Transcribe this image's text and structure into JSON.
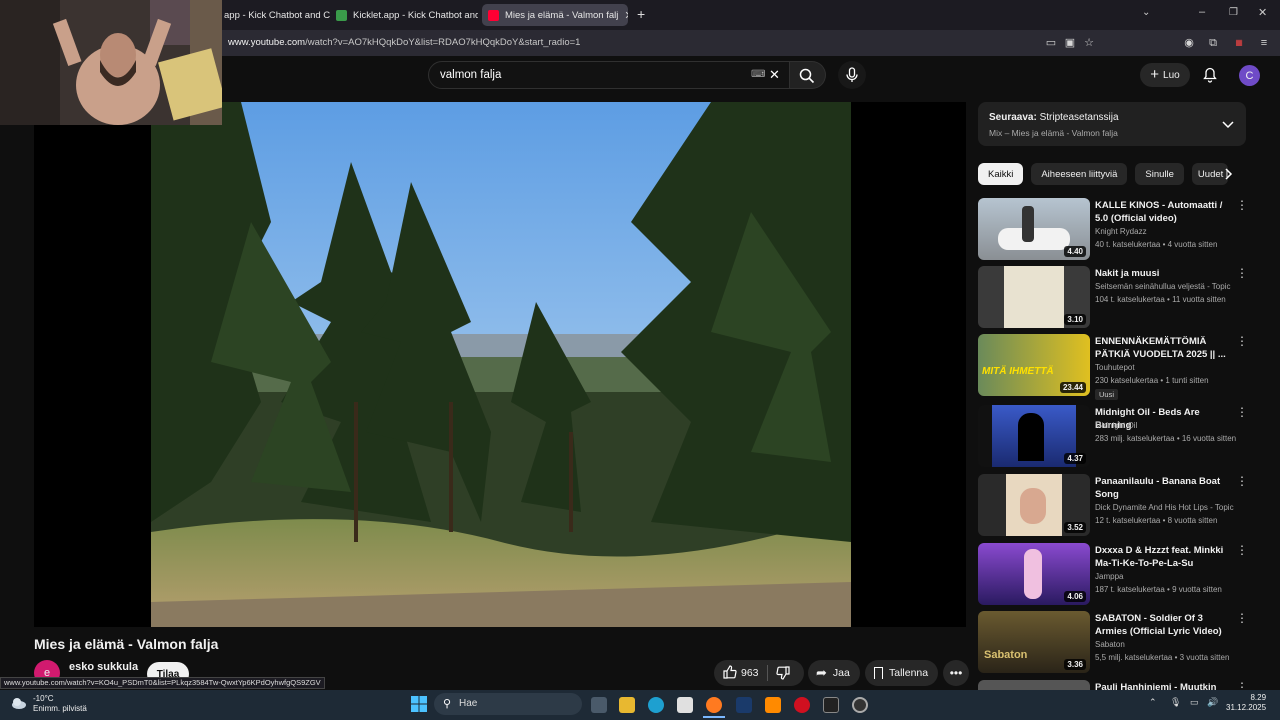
{
  "browser": {
    "tabs": [
      {
        "label": "app - Kick Chatbot and C"
      },
      {
        "label": "Kicklet.app - Kick Chatbot and C"
      },
      {
        "label": "Mies ja elämä - Valmon falj"
      }
    ],
    "url_prefix": "www.youtube.com",
    "url_rest": "/watch?v=AO7kHQqkDoY&list=RDAO7kHQqkDoY&start_radio=1",
    "status_url": "www.youtube.com/watch?v=KO4u_PSDmT0&list=PLkqz3584Tw-QwxtYp6KPdOyhwfgQS9ZGV"
  },
  "youtube": {
    "search_value": "valmon falja",
    "create_label": "Luo",
    "avatar_letter": "C"
  },
  "video": {
    "title": "Mies ja elämä - Valmon falja",
    "channel_initial": "e",
    "channel": "esko sukkula",
    "subscribe_label": "Tilaa",
    "likes": "963",
    "share_label": "Jaa",
    "save_label": "Tallenna"
  },
  "next_up": {
    "label": "Seuraava:",
    "title": "Stripteasetanssija",
    "mix": "Mix – Mies ja elämä - Valmon falja"
  },
  "chips": [
    "Kaikki",
    "Aiheeseen liittyviä",
    "Sinulle",
    "Uudet l"
  ],
  "recommendations": [
    {
      "title": "KALLE KINOS - Automaatti / 5.0 (Official video)",
      "channel": "Knight Rydazz",
      "meta": "40 t. katselukertaa • 4 vuotta sitten",
      "duration": "4.40"
    },
    {
      "title": "Nakit ja muusi",
      "channel": "Seitsemän seinähullua veljestä - Topic",
      "meta": "104 t. katselukertaa • 11 vuotta sitten",
      "duration": "3.10"
    },
    {
      "title": "ENNENNÄKEMÄTTÖMIÄ PÄTKIÄ VUODELTA 2025 || ...",
      "channel": "Touhutepot",
      "meta": "230 katselukertaa • 1 tunti sitten",
      "duration": "23.44",
      "badge": "Uusi"
    },
    {
      "title": "Midnight Oil - Beds Are Burning",
      "channel": "Midnight Oil",
      "meta": "283 milj. katselukertaa • 16 vuotta sitten",
      "duration": "4.37"
    },
    {
      "title": "Panaanilaulu - Banana Boat Song",
      "channel": "Dick Dynamite And His Hot Lips - Topic",
      "meta": "12 t. katselukertaa • 8 vuotta sitten",
      "duration": "3.52"
    },
    {
      "title": "Dxxxa D & Hzzzt feat. Minkki Ma-Ti-Ke-To-Pe-La-Su",
      "channel": "Jamppa",
      "meta": "187 t. katselukertaa • 9 vuotta sitten",
      "duration": "4.06"
    },
    {
      "title": "SABATON - Soldier Of 3 Armies (Official Lyric Video)",
      "channel": "Sabaton",
      "meta": "5,5 milj. katselukertaa • 3 vuotta sitten",
      "duration": "3.36"
    },
    {
      "title": "Pauli Hanhiniemi - Muutkin",
      "channel": "",
      "meta": "",
      "duration": ""
    }
  ],
  "taskbar": {
    "temp": "-10°C",
    "weather": "Enimm. pilvistä",
    "search_placeholder": "Hae",
    "time": "8.29",
    "date": "31.12.2025"
  }
}
